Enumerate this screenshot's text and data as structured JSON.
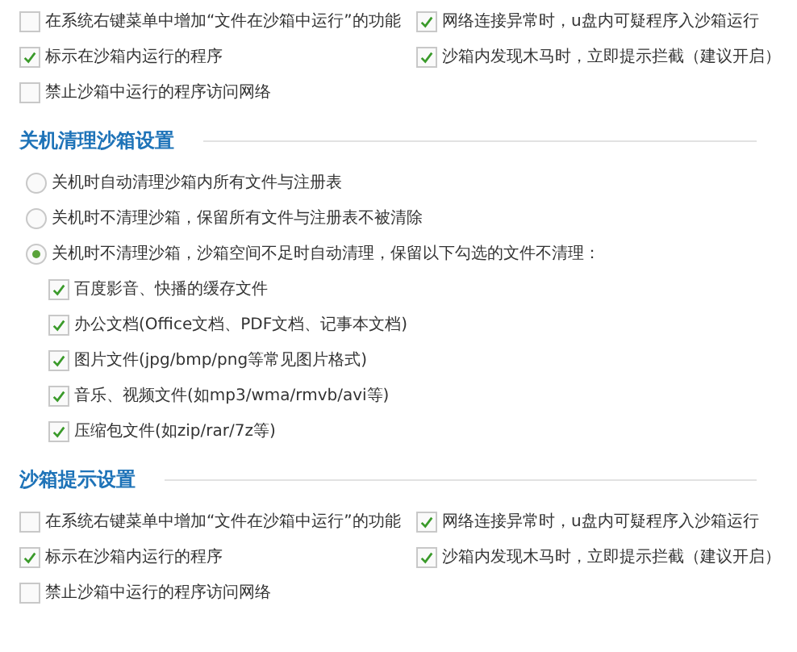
{
  "top_section": {
    "options": [
      {
        "label": "在系统右键菜单中增加“文件在沙箱中运行”的功能",
        "checked": false
      },
      {
        "label": "网络连接异常时，u盘内可疑程序入沙箱运行",
        "checked": true
      },
      {
        "label": "标示在沙箱内运行的程序",
        "checked": true
      },
      {
        "label": "沙箱内发现木马时，立即提示拦截（建议开启）",
        "checked": true
      },
      {
        "label": "禁止沙箱中运行的程序访问网络",
        "checked": false
      }
    ]
  },
  "shutdown_cleanup": {
    "title": "关机清理沙箱设置",
    "modes": [
      {
        "label": "关机时自动清理沙箱内所有文件与注册表",
        "selected": false
      },
      {
        "label": "关机时不清理沙箱，保留所有文件与注册表不被清除",
        "selected": false
      },
      {
        "label": "关机时不清理沙箱，沙箱空间不足时自动清理，保留以下勾选的文件不清理：",
        "selected": true
      }
    ],
    "keep_files": [
      {
        "label": "百度影音、快播的缓存文件",
        "checked": true
      },
      {
        "label": "办公文档(Office文档、PDF文档、记事本文档)",
        "checked": true
      },
      {
        "label": "图片文件(jpg/bmp/png等常见图片格式)",
        "checked": true
      },
      {
        "label": "音乐、视频文件(如mp3/wma/rmvb/avi等)",
        "checked": true
      },
      {
        "label": "压缩包文件(如zip/rar/7z等)",
        "checked": true
      }
    ]
  },
  "sandbox_prompt": {
    "title": "沙箱提示设置",
    "options": [
      {
        "label": "在系统右键菜单中增加“文件在沙箱中运行”的功能",
        "checked": false
      },
      {
        "label": "网络连接异常时，u盘内可疑程序入沙箱运行",
        "checked": true
      },
      {
        "label": "标示在沙箱内运行的程序",
        "checked": true
      },
      {
        "label": "沙箱内发现木马时，立即提示拦截（建议开启）",
        "checked": true
      },
      {
        "label": "禁止沙箱中运行的程序访问网络",
        "checked": false
      }
    ]
  }
}
